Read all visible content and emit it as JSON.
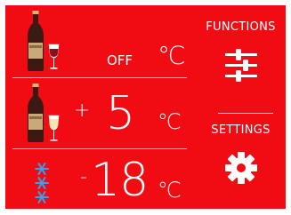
{
  "zones": [
    {
      "id": "red-wine",
      "icon": "red-wine-bottle-glass-icon",
      "state": "OFF",
      "unit": "℃"
    },
    {
      "id": "white-wine",
      "icon": "white-wine-bottle-glass-icon",
      "sign": "+",
      "value": "5",
      "unit": "℃"
    },
    {
      "id": "freezer",
      "icon": "snowflakes-icon",
      "sign": "-",
      "value": "18",
      "unit": "℃"
    }
  ],
  "menu": {
    "functions_label": "FUNCTIONS",
    "functions_icon": "sliders-icon",
    "settings_label": "SETTINGS",
    "settings_icon": "gear-icon"
  },
  "colors": {
    "background": "#f10b13",
    "foreground": "#ffffff",
    "bottle": "#3a1a12",
    "label_tan": "#c8a97a",
    "red_wine": "#8a1020",
    "white_wine": "#f2e6b4",
    "snowflake": "#3aa0ea"
  }
}
